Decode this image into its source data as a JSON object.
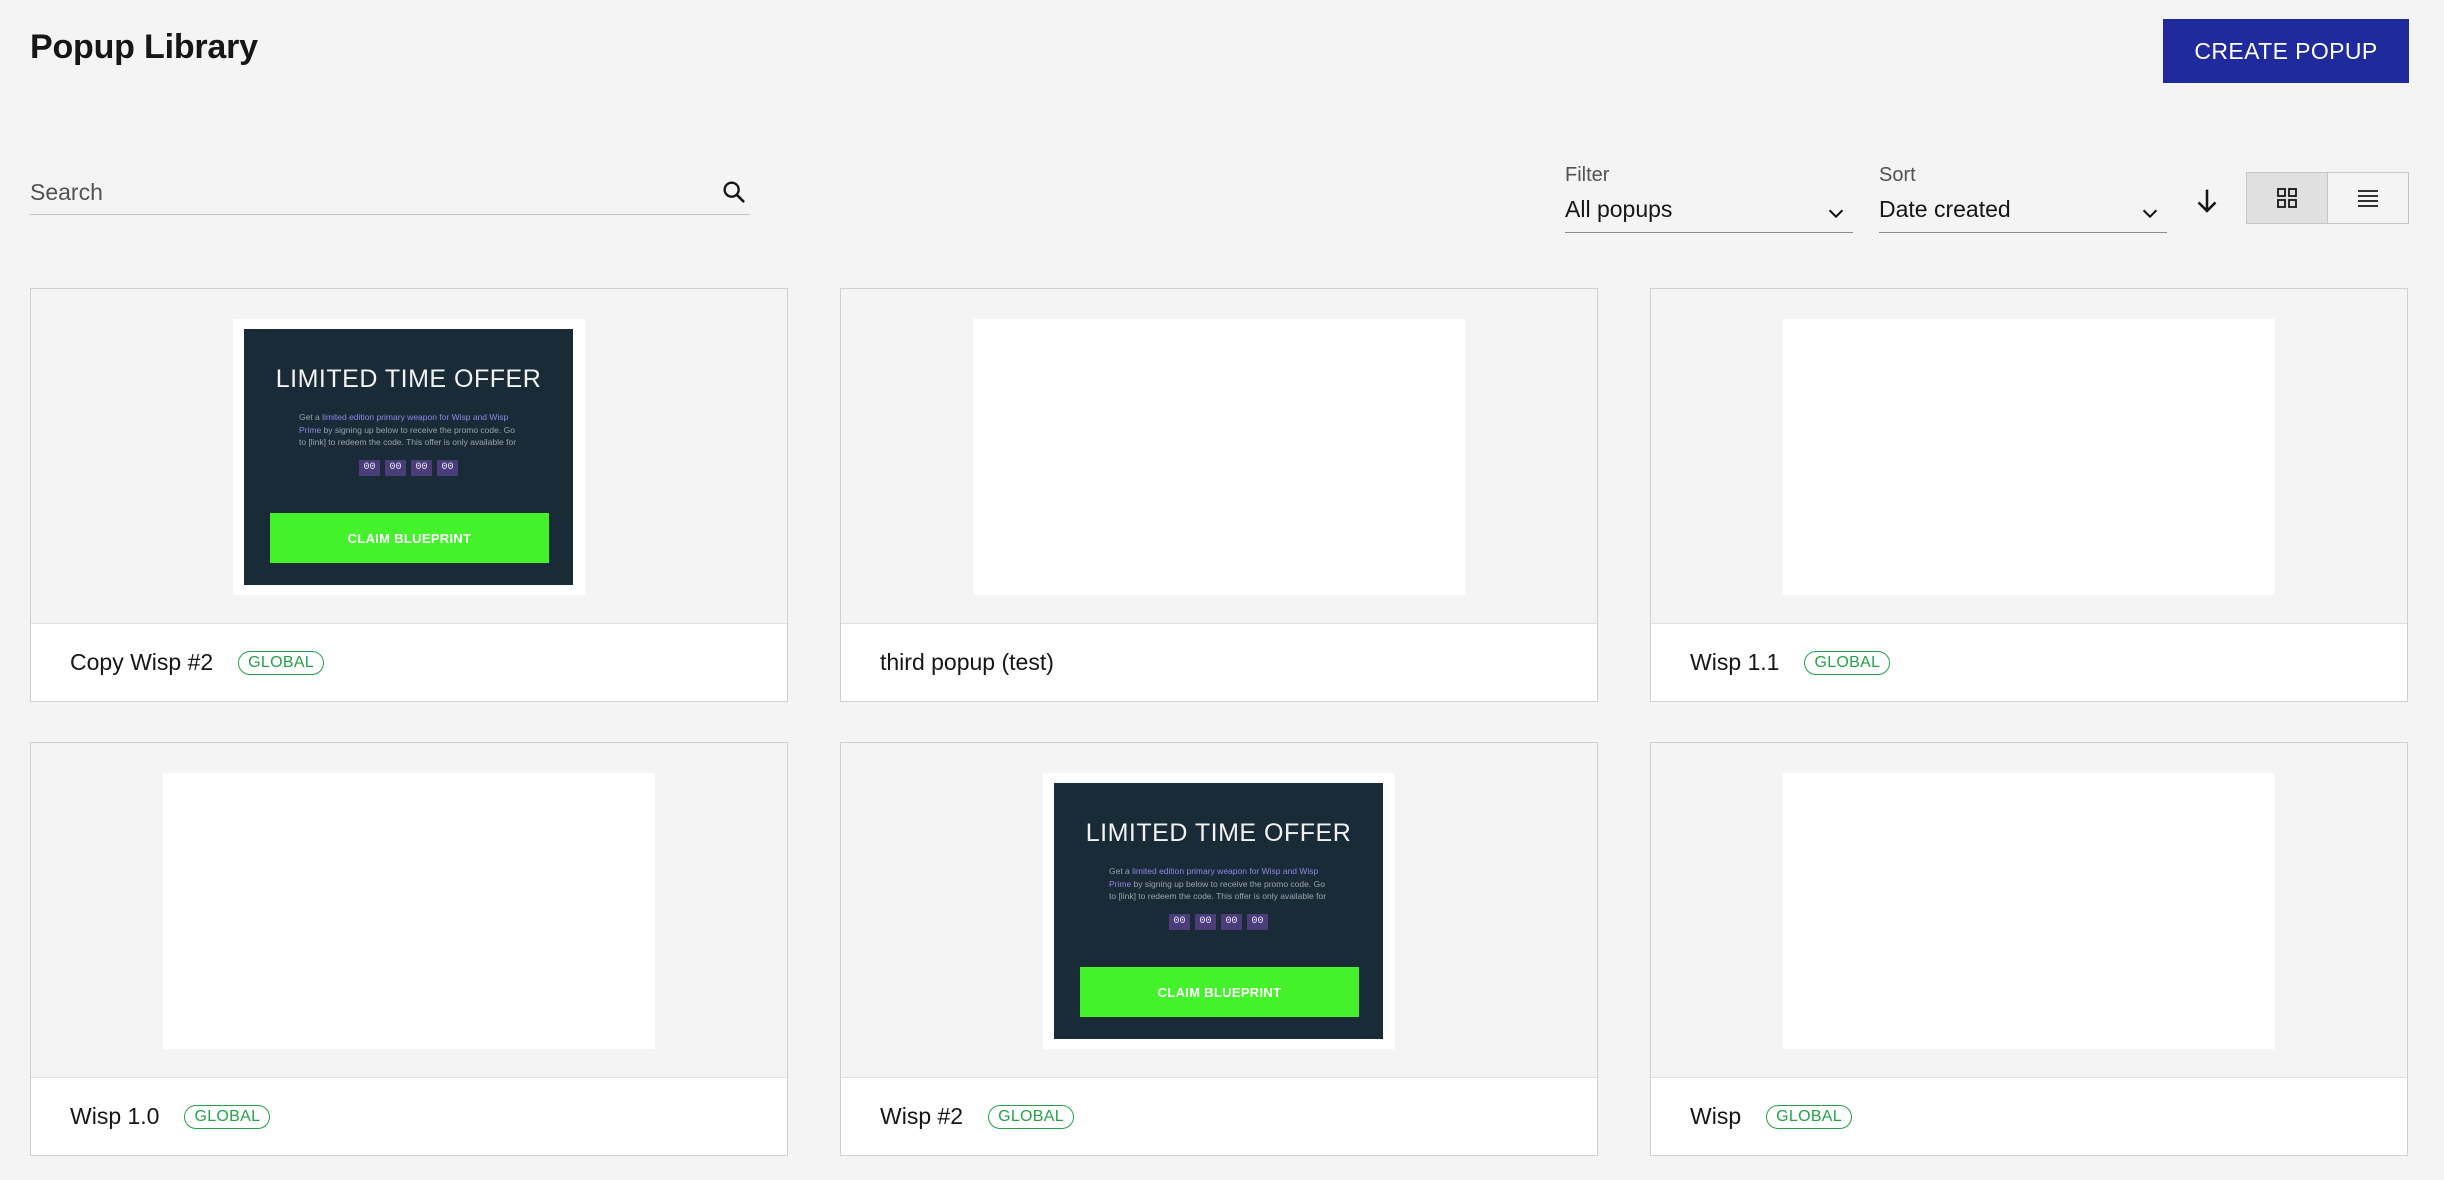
{
  "header": {
    "title": "Popup Library",
    "create_label": "CREATE POPUP"
  },
  "toolbar": {
    "search_placeholder": "Search",
    "filter_label": "Filter",
    "filter_value": "All popups",
    "sort_label": "Sort",
    "sort_value": "Date created",
    "sort_direction_icon": "arrow-down-icon",
    "view_modes": [
      "grid-view-icon",
      "list-view-icon"
    ],
    "active_view": "grid"
  },
  "cards": [
    {
      "name": "Copy Wisp #2",
      "badge": "GLOBAL",
      "preview": "offer"
    },
    {
      "name": "third popup (test)",
      "badge": "",
      "preview": "blank"
    },
    {
      "name": "Wisp 1.1",
      "badge": "GLOBAL",
      "preview": "blank"
    },
    {
      "name": "Wisp 1.0",
      "badge": "GLOBAL",
      "preview": "blank"
    },
    {
      "name": "Wisp #2",
      "badge": "GLOBAL",
      "preview": "offer"
    },
    {
      "name": "Wisp",
      "badge": "GLOBAL",
      "preview": "blank"
    }
  ],
  "offer_preview": {
    "headline": "LIMITED TIME OFFER",
    "body_before": "Get a ",
    "body_highlight": "limited edition primary weapon for Wisp and Wisp Prime",
    "body_after": " by signing up below to receive the promo code. Go to [link] to redeem the code. This offer is only available for",
    "timer": [
      "00",
      "00",
      "00",
      "00"
    ],
    "cta": "CLAIM BLUEPRINT"
  },
  "colors": {
    "primary": "#1f2a9c",
    "badge_green": "#24a148",
    "preview_panel": "#1a2b38",
    "cta_green": "#43f22a",
    "highlight_purple": "#8f86e8"
  }
}
